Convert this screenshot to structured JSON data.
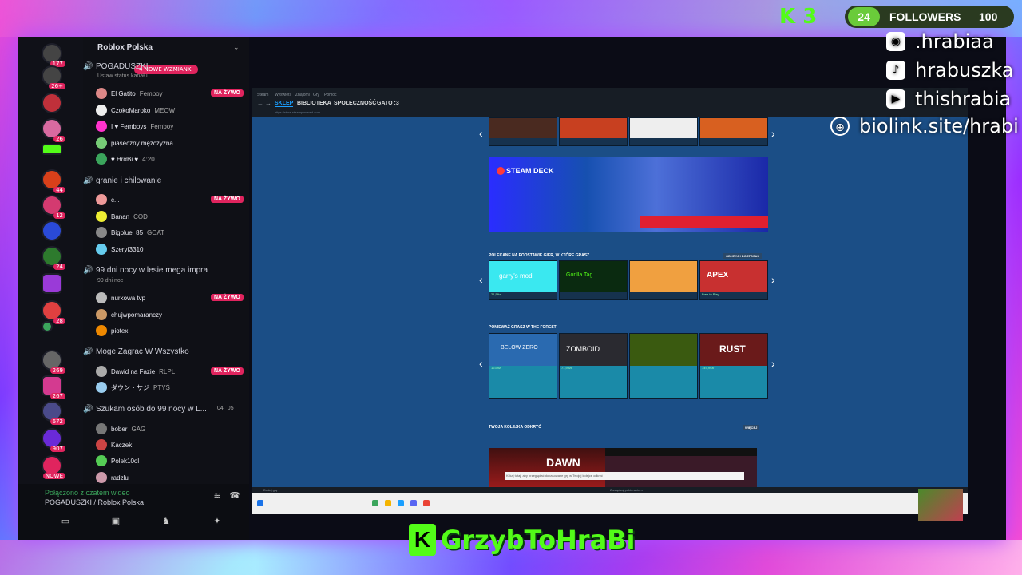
{
  "discord": {
    "server_name": "Roblox Polska",
    "mentions_badge": "4 NOWE WZMIANKI",
    "rail_badges": [
      "177",
      "26+",
      "26",
      "44",
      "12",
      "24",
      "28",
      "269",
      "267",
      "672",
      "907",
      "NOWE"
    ],
    "channels": [
      {
        "name": "POGADUSZKI",
        "status": "Ustaw status kanału",
        "users": [
          {
            "name": "El Gatito",
            "tag": "Femboy",
            "live": true
          },
          {
            "name": "CzokoMaroko",
            "tag": "MEOW",
            "live": false
          },
          {
            "name": "I ♥ Femboys",
            "tag": "Femboy",
            "live": false
          },
          {
            "name": "piaseczny mężczyzna",
            "tag": "",
            "live": false
          },
          {
            "name": "♥ HrαBi ♥",
            "tag": "4:20",
            "live": false
          }
        ]
      },
      {
        "name": "granie i chilowanie",
        "status": "",
        "users": [
          {
            "name": "c...",
            "tag": "",
            "live": true
          },
          {
            "name": "Banan",
            "tag": "COD",
            "live": false
          },
          {
            "name": "Bigblue_85",
            "tag": "GOAT",
            "live": false
          },
          {
            "name": "Szeryf3310",
            "tag": "",
            "live": false
          }
        ]
      },
      {
        "name": "99 dni nocy w lesie mega impra",
        "status": "99 dni noc",
        "users": [
          {
            "name": "nurkowa tvp",
            "tag": "",
            "live": true
          },
          {
            "name": "chujwpomaranczy",
            "tag": "",
            "live": false
          },
          {
            "name": "piotex",
            "tag": "",
            "live": false
          }
        ]
      },
      {
        "name": "Moge Zagrac W Wszystko",
        "status": "",
        "users": [
          {
            "name": "Dawid na Fazie",
            "tag": "RLPL",
            "live": true
          },
          {
            "name": "ダウン・サジ",
            "tag": "PTYŚ",
            "live": false
          }
        ]
      },
      {
        "name": "Szukam osób do 99 nocy w L...",
        "status": "",
        "count_a": "04",
        "count_b": "05",
        "users": [
          {
            "name": "bober",
            "tag": "GAG",
            "live": false
          },
          {
            "name": "Kaczek",
            "tag": "",
            "live": false
          },
          {
            "name": "Polek10ol",
            "tag": "",
            "live": false
          },
          {
            "name": "radzlu",
            "tag": "",
            "live": false
          }
        ]
      }
    ],
    "live_label": "NA ŻYWO",
    "footer_status": "Połączono z czatem wideo",
    "footer_channel": "POGADUSZKI / Roblox Polska"
  },
  "steam": {
    "nav_small": [
      "Steam",
      "Wyświetl",
      "Znajomi",
      "Gry",
      "Pomoc"
    ],
    "nav_main": [
      "SKLEP",
      "BIBLIOTEKA",
      "SPOŁECZNOŚĆ",
      "GATO :3"
    ],
    "url": "https://store.steampowered.com",
    "banner_title": "STEAM DECK",
    "section_recommended": "POLECANE NA PODSTAWIE GIER, W KTÓRE GRASZ",
    "section_recommended_btn": "ODKRYJ I DOSTOSUJ",
    "section_forest": "PONIEWAŻ GRASZ W THE FOREST",
    "section_queue": "TWOJA KOLEJKA ODKRYĆ",
    "queue_btn": "WIĘCEJ",
    "recommended_tiles": [
      "garry's mod",
      "Gorilla Tag",
      "",
      "APEX"
    ],
    "recommended_prices": [
      "21,59zł",
      "",
      "",
      "Free to Play"
    ],
    "forest_tiles": [
      "BELOW ZERO",
      "ZOMBOID",
      "",
      "RUST"
    ],
    "forest_prices": [
      "123,9zł",
      "71,99zł",
      "",
      "149,99zł"
    ],
    "queue_title": "DAWN",
    "queue_text": "Klikaj tutaj, aby przeglądać dopasowane gry w Twojej kolejce odkryć",
    "taskbar_left": "Dodaj grę",
    "taskbar_center": "Zarządzaj pobieraniem"
  },
  "overlay": {
    "kick_count": "3",
    "followers_count": "24",
    "followers_label": "FOLLOWERS",
    "followers_goal": "100",
    "socials": [
      {
        "icon": "discord-icon",
        "text": ".hrabiaa"
      },
      {
        "icon": "tiktok-icon",
        "text": "hrabuszka"
      },
      {
        "icon": "youtube-icon",
        "text": "thishrabia"
      },
      {
        "icon": "globe-icon",
        "text": "biolink.site/hrabi"
      }
    ],
    "bottom_name": "GrzybToHraBi",
    "brand_color": "#53fc18"
  }
}
